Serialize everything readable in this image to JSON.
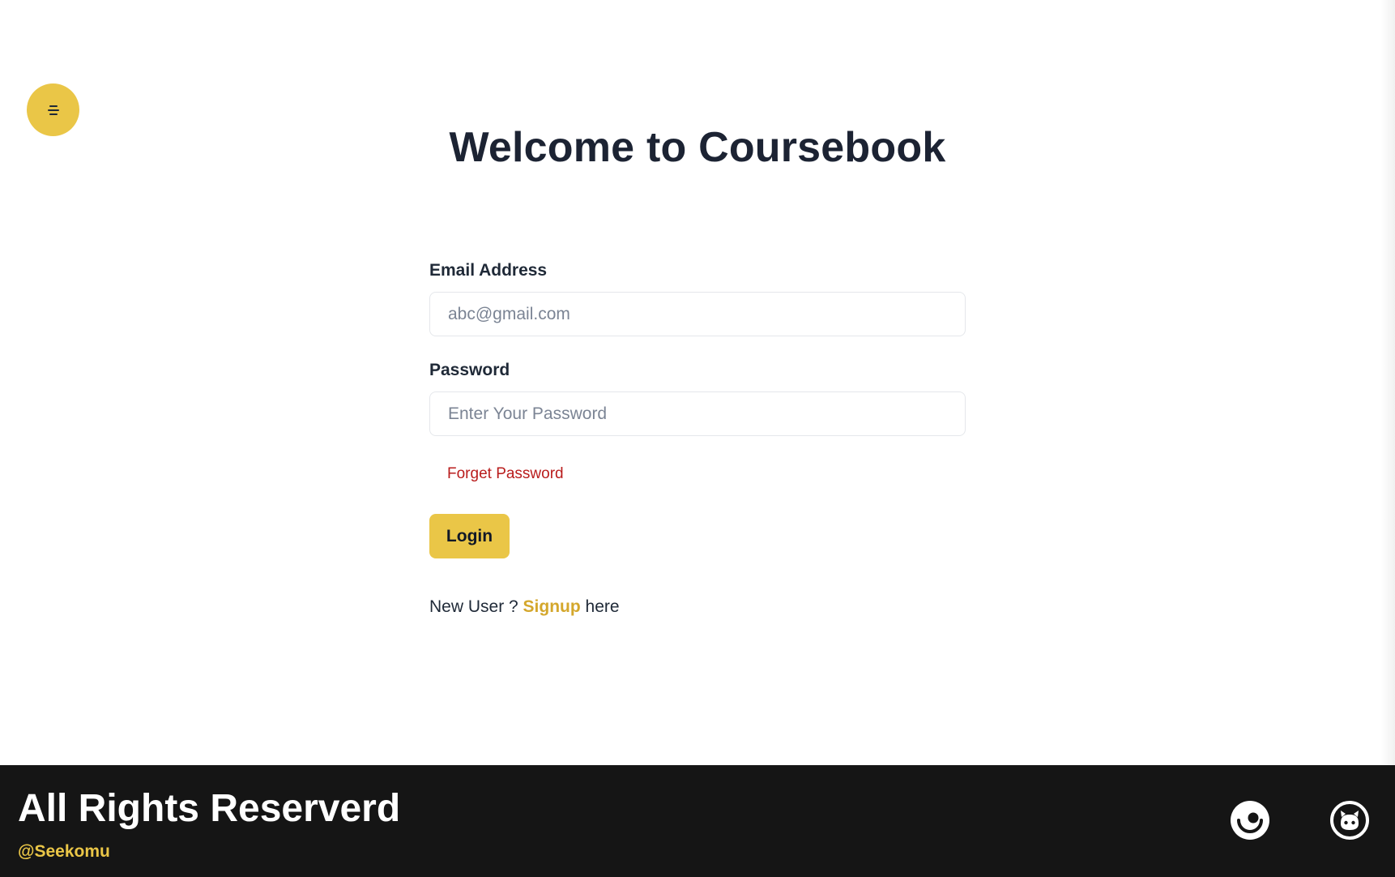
{
  "header": {
    "menu_icon": "menu-icon"
  },
  "main": {
    "title": "Welcome to Coursebook",
    "email": {
      "label": "Email Address",
      "placeholder": "abc@gmail.com",
      "value": ""
    },
    "password": {
      "label": "Password",
      "placeholder": "Enter Your Password",
      "value": ""
    },
    "forgot_password": "Forget Password",
    "login_button": "Login",
    "signup": {
      "prefix": "New User ?",
      "link": "Signup",
      "suffix": "here"
    }
  },
  "footer": {
    "title": "All Rights Reserverd",
    "handle": "@Seekomu",
    "icons": [
      "dribbble-icon",
      "github-icon"
    ]
  },
  "colors": {
    "accent": "#eac647",
    "link": "#d4a72c",
    "danger": "#b91c1c",
    "footer_bg": "#151515",
    "title": "#1c2333"
  }
}
